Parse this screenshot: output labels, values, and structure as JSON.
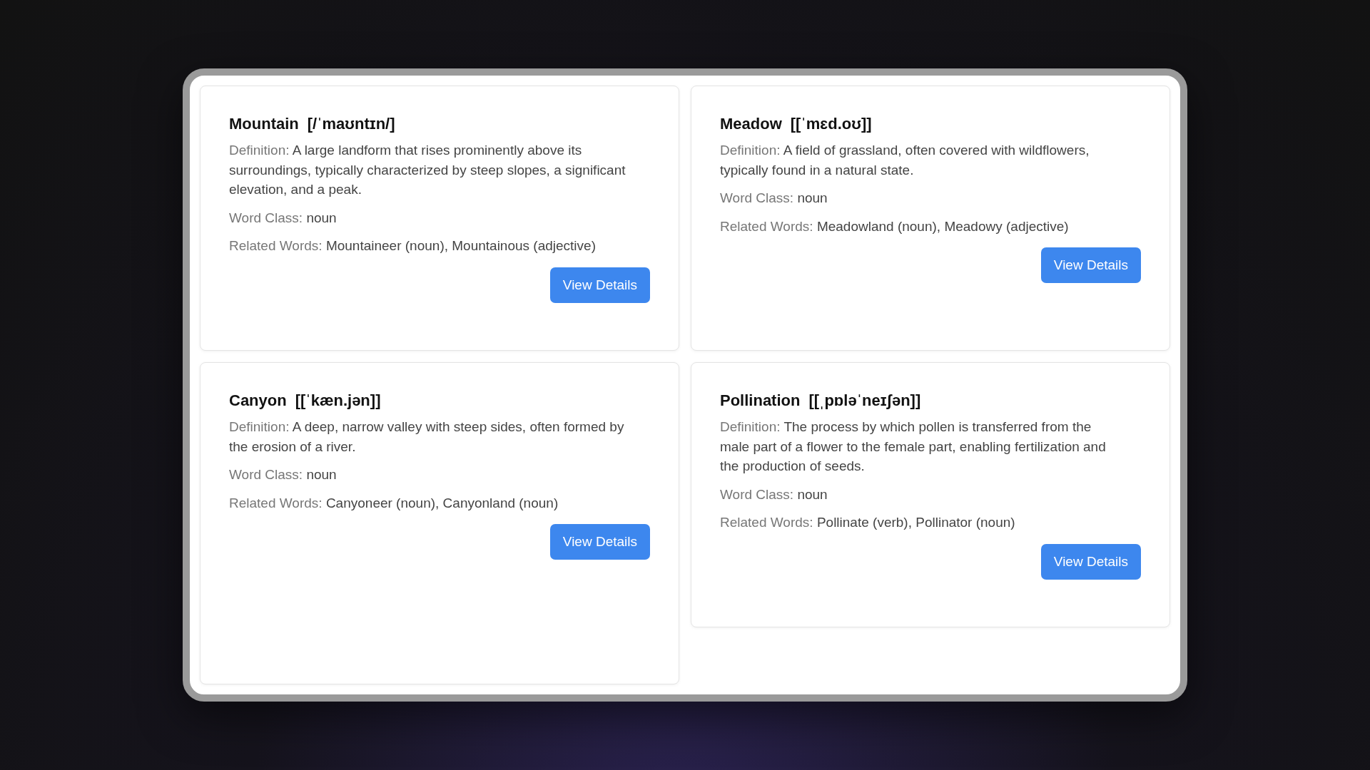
{
  "cards": [
    {
      "word": "Mountain",
      "pronunciation": "[/ˈmaʊntɪn/]",
      "definition": {
        "label": "Definition:",
        "value": "A large landform that rises prominently above its surroundings, typically characterized by steep slopes, a significant elevation, and a peak."
      },
      "word_class": {
        "label": "Word Class:",
        "value": "noun"
      },
      "related": {
        "label": "Related Words:",
        "value": "Mountaineer (noun), Mountainous (adjective)"
      },
      "button": "View Details"
    },
    {
      "word": "Meadow",
      "pronunciation": "[[ˈmɛd.oʊ]]",
      "definition": {
        "label": "Definition:",
        "value": "A field of grassland, often covered with wildflowers, typically found in a natural state."
      },
      "word_class": {
        "label": "Word Class:",
        "value": "noun"
      },
      "related": {
        "label": "Related Words:",
        "value": "Meadowland (noun), Meadowy (adjective)"
      },
      "button": "View Details"
    },
    {
      "word": "Canyon",
      "pronunciation": "[[ˈkæn.jən]]",
      "definition": {
        "label": "Definition:",
        "value": "A deep, narrow valley with steep sides, often formed by the erosion of a river."
      },
      "word_class": {
        "label": "Word Class:",
        "value": "noun"
      },
      "related": {
        "label": "Related Words:",
        "value": "Canyoneer (noun), Canyonland (noun)"
      },
      "button": "View Details"
    },
    {
      "word": "Pollination",
      "pronunciation": "[[ˌpɒləˈneɪʃən]]",
      "definition": {
        "label": "Definition:",
        "value": "The process by which pollen is transferred from the male part of a flower to the female part, enabling fertilization and the production of seeds."
      },
      "word_class": {
        "label": "Word Class:",
        "value": "noun"
      },
      "related": {
        "label": "Related Words:",
        "value": "Pollinate (verb), Pollinator (noun)"
      },
      "button": "View Details"
    }
  ]
}
